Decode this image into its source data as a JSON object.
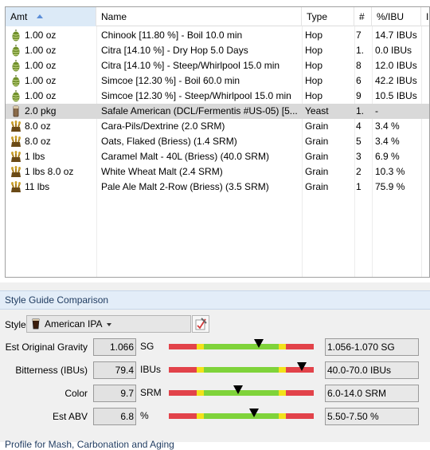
{
  "table": {
    "columns": {
      "amt": "Amt",
      "name": "Name",
      "type": "Type",
      "num": "#",
      "ibu": "%/IBU",
      "extra": "In"
    },
    "rows": [
      {
        "icon": "hop",
        "amount": "1.00 oz",
        "name": "Chinook [11.80 %] - Boil 10.0 min",
        "type": "Hop",
        "num": "7",
        "ibu": "14.7 IBUs"
      },
      {
        "icon": "hop",
        "amount": "1.00 oz",
        "name": "Citra [14.10 %] - Dry Hop 5.0 Days",
        "type": "Hop",
        "num": "1.",
        "ibu": "0.0 IBUs"
      },
      {
        "icon": "hop",
        "amount": "1.00 oz",
        "name": "Citra [14.10 %] - Steep/Whirlpool  15.0 min",
        "type": "Hop",
        "num": "8",
        "ibu": "12.0 IBUs"
      },
      {
        "icon": "hop",
        "amount": "1.00 oz",
        "name": "Simcoe [12.30 %] - Boil 60.0 min",
        "type": "Hop",
        "num": "6",
        "ibu": "42.2 IBUs"
      },
      {
        "icon": "hop",
        "amount": "1.00 oz",
        "name": "Simcoe [12.30 %] - Steep/Whirlpool  15.0 min",
        "type": "Hop",
        "num": "9",
        "ibu": "10.5 IBUs"
      },
      {
        "icon": "yeast",
        "amount": "2.0 pkg",
        "name": "Safale American  (DCL/Fermentis #US-05) [5...",
        "type": "Yeast",
        "num": "1.",
        "ibu": "-"
      },
      {
        "icon": "grain",
        "amount": "8.0 oz",
        "name": "Cara-Pils/Dextrine (2.0 SRM)",
        "type": "Grain",
        "num": "4",
        "ibu": "3.4 %"
      },
      {
        "icon": "grain",
        "amount": "8.0 oz",
        "name": "Oats, Flaked (Briess) (1.4 SRM)",
        "type": "Grain",
        "num": "5",
        "ibu": "3.4 %"
      },
      {
        "icon": "grain",
        "amount": "1 lbs",
        "name": "Caramel Malt - 40L (Briess) (40.0 SRM)",
        "type": "Grain",
        "num": "3",
        "ibu": "6.9 %"
      },
      {
        "icon": "grain",
        "amount": "1 lbs 8.0 oz",
        "name": "White Wheat Malt (2.4 SRM)",
        "type": "Grain",
        "num": "2",
        "ibu": "10.3 %"
      },
      {
        "icon": "grain",
        "amount": "11 lbs",
        "name": "Pale Ale Malt 2-Row (Briess) (3.5 SRM)",
        "type": "Grain",
        "num": "1",
        "ibu": "75.9 %"
      }
    ]
  },
  "style_guide": {
    "title": "Style Guide Comparison",
    "style_label": "Style",
    "style_value": "American IPA",
    "rows": [
      {
        "label": "Est Original Gravity",
        "value": "1.066",
        "unit": "SG",
        "range": "1.056-1.070 SG",
        "marker_pos": 0.62
      },
      {
        "label": "Bitterness (IBUs)",
        "value": "79.4",
        "unit": "IBUs",
        "range": "40.0-70.0 IBUs",
        "marker_pos": 0.92
      },
      {
        "label": "Color",
        "value": "9.7",
        "unit": "SRM",
        "range": "6.0-14.0 SRM",
        "marker_pos": 0.48
      },
      {
        "label": "Est ABV",
        "value": "6.8",
        "unit": "%",
        "range": "5.50-7.50 %",
        "marker_pos": 0.59
      }
    ],
    "footer": "Profile for Mash, Carbonation and Aging"
  },
  "colors": {
    "red": "#e2434a",
    "yellow": "#f2e21a",
    "green": "#7fd33a",
    "selected_row": "#d9d9d9"
  }
}
